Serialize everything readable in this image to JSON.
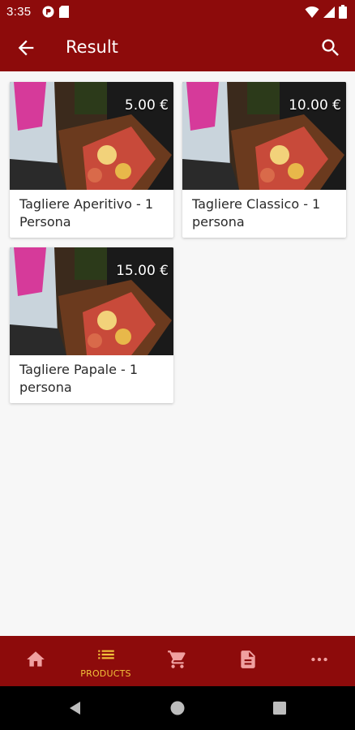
{
  "status_bar": {
    "time": "3:35"
  },
  "app_bar": {
    "title": "Result"
  },
  "products": [
    {
      "name": "Tagliere Aperitivo - 1 Persona",
      "price": "5.00 €"
    },
    {
      "name": "Tagliere Classico - 1 persona",
      "price": "10.00 €"
    },
    {
      "name": "Tagliere Papale - 1 persona",
      "price": "15.00 €"
    }
  ],
  "bottom_nav": {
    "items": [
      {
        "icon": "home-icon",
        "label": ""
      },
      {
        "icon": "list-icon",
        "label": "PRODUCTS",
        "active": true
      },
      {
        "icon": "cart-icon",
        "label": ""
      },
      {
        "icon": "document-icon",
        "label": ""
      },
      {
        "icon": "more-icon",
        "label": ""
      }
    ]
  },
  "colors": {
    "primary": "#8d0b0b",
    "accent": "#f2c23a",
    "inactive_icon": "#f0a0a0",
    "background": "#f7f7f7"
  }
}
